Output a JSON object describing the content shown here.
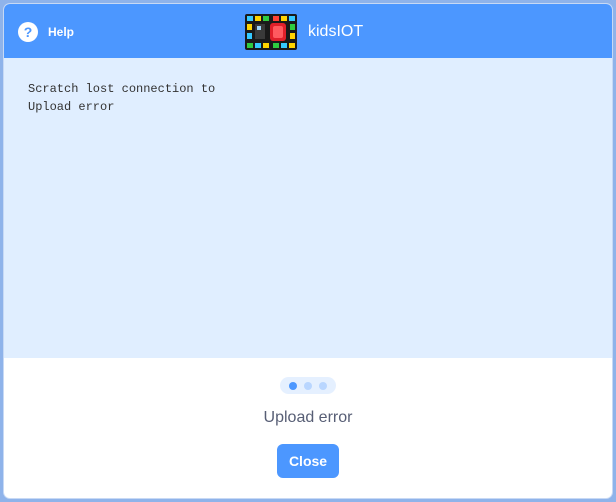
{
  "header": {
    "help_label": "Help",
    "help_icon": "?",
    "title": "kidsIOT",
    "device_icon": "device-board-icon"
  },
  "log": {
    "text": "Scratch lost connection to\nUpload error"
  },
  "progress": {
    "steps": 3,
    "active_step": 1
  },
  "status": {
    "text": "Upload error"
  },
  "actions": {
    "close_label": "Close"
  },
  "colors": {
    "accent": "#4c97ff",
    "log_background": "#e0eeff",
    "status_text": "#575e75"
  }
}
